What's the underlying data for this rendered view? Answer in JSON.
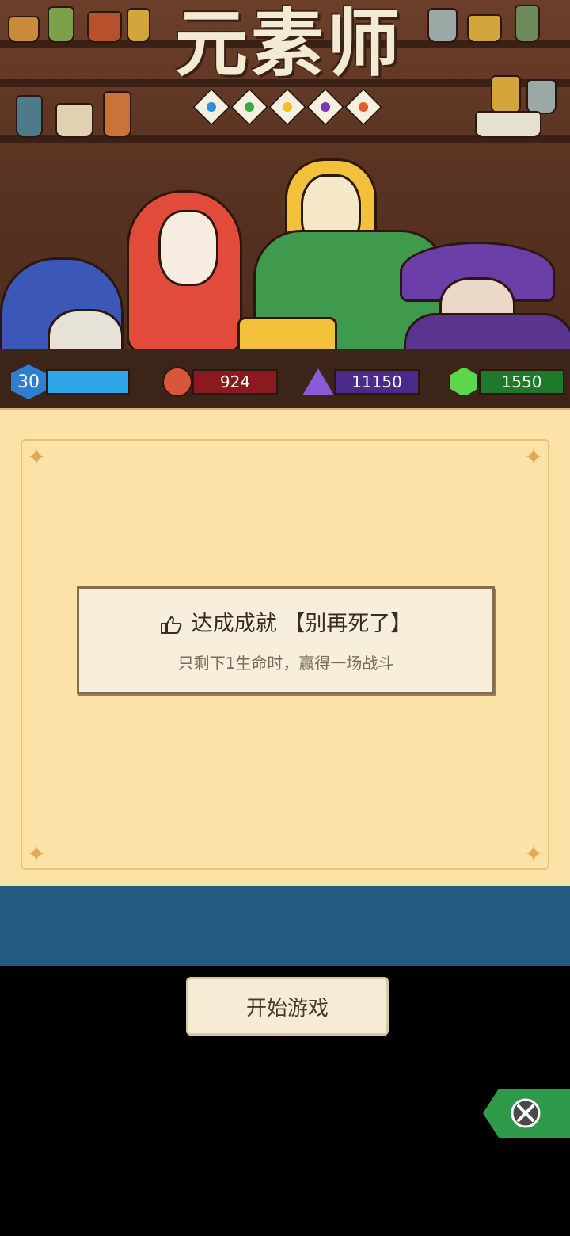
{
  "game": {
    "title": "元素师",
    "element_gems": [
      "water-gem-icon",
      "nature-gem-icon",
      "light-gem-icon",
      "dark-gem-icon",
      "fire-gem-icon"
    ]
  },
  "stats": {
    "level": "30",
    "level_progress": 1.0,
    "red_gem_count": "924",
    "purple_crystal_count": "11150",
    "green_crystal_count": "1550"
  },
  "achievement": {
    "title": "达成成就 【别再死了】",
    "description": "只剩下1生命时，赢得一场战斗"
  },
  "start_button": {
    "label": "开始游戏"
  },
  "colors": {
    "panel": "#fbe3a8",
    "bluebar": "#255a80",
    "level_bar": "#2fa6e9",
    "red_bar": "#8b1a1f",
    "purple_bar": "#4a2a8a",
    "green_bar": "#1e7a2a"
  }
}
